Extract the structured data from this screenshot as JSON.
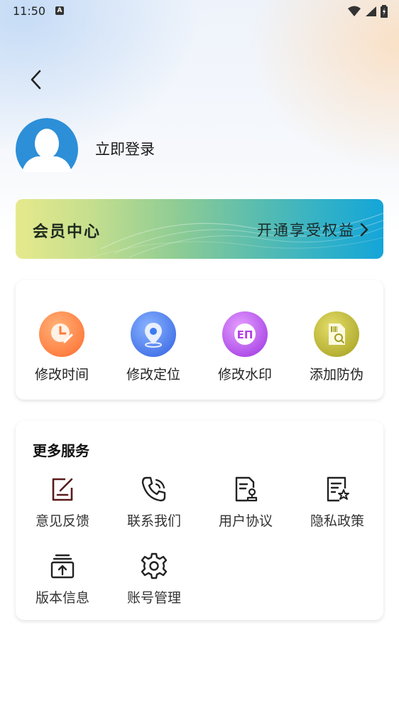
{
  "status_bar": {
    "time": "11:50",
    "notification_badge": "A",
    "icons": [
      "wifi-icon",
      "signal-icon",
      "battery-charging-icon"
    ]
  },
  "header": {
    "back_icon": "chevron-left-icon"
  },
  "profile": {
    "avatar_icon": "default-avatar-icon",
    "login_label": "立即登录",
    "avatar_color": "#2c8fd8"
  },
  "vip": {
    "title": "会员中心",
    "cta": "开通享受权益",
    "cta_icon": "chevron-right-icon"
  },
  "tools": [
    {
      "label": "修改时间",
      "icon": "clock-edit-icon",
      "color": "#ff7a3c"
    },
    {
      "label": "修改定位",
      "icon": "location-pin-icon",
      "color": "#3a7bf0"
    },
    {
      "label": "修改水印",
      "icon": "watermark-stamp-icon",
      "color": "#b43fe8"
    },
    {
      "label": "添加防伪",
      "icon": "anti-counterfeit-icon",
      "color": "#b9b52a"
    }
  ],
  "services": {
    "title": "更多服务",
    "items": [
      {
        "label": "意见反馈",
        "icon": "feedback-edit-icon"
      },
      {
        "label": "联系我们",
        "icon": "phone-call-icon"
      },
      {
        "label": "用户协议",
        "icon": "user-agreement-icon"
      },
      {
        "label": "隐私政策",
        "icon": "privacy-policy-icon"
      },
      {
        "label": "版本信息",
        "icon": "version-upload-icon"
      },
      {
        "label": "账号管理",
        "icon": "gear-icon"
      }
    ]
  }
}
